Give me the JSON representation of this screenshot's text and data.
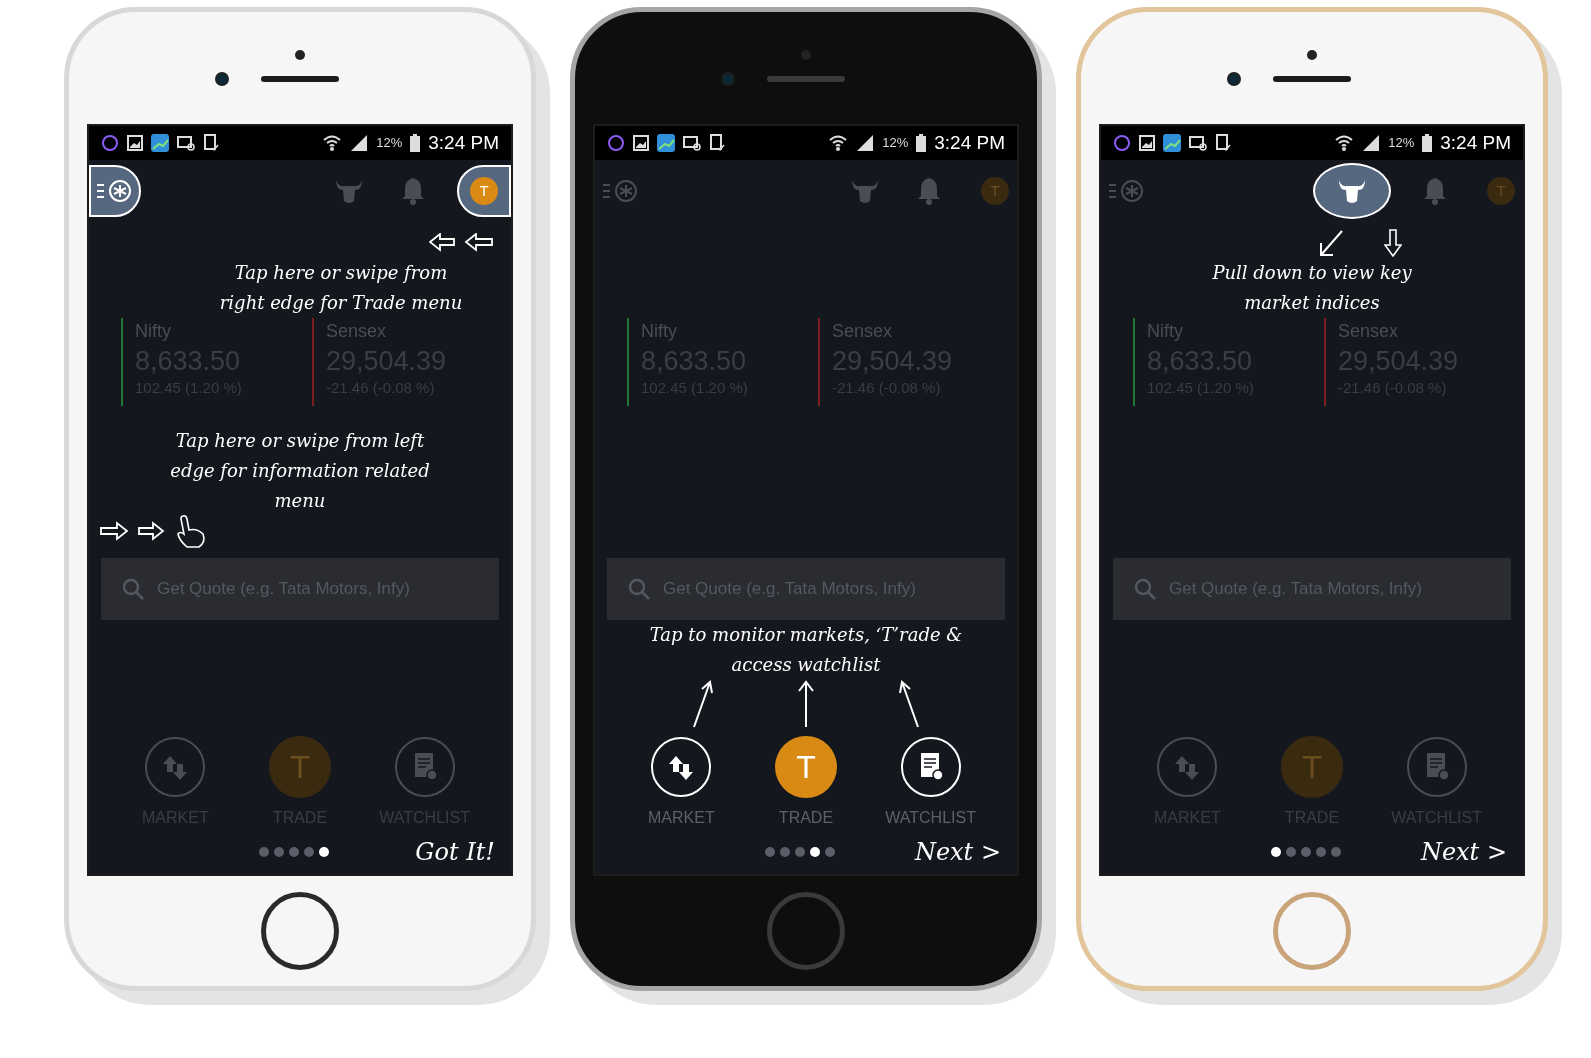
{
  "phones": [
    {
      "kind": "white",
      "status_bar": {
        "battery": "12%",
        "time": "3:24 PM"
      },
      "top_bar": {
        "menu_highlighted": true,
        "bull_highlighted": false,
        "avatar_highlighted": true,
        "avatar": "T"
      },
      "indices": [
        {
          "name": "Nifty",
          "value": "8,633.50",
          "change": "102.45 (1.20 %)",
          "color": "#1f7a3a"
        },
        {
          "name": "Sensex",
          "value": "29,504.39",
          "change": "-21.46 (-0.08 %)",
          "color": "#7a1f1f"
        }
      ],
      "search": {
        "placeholder": "Get Quote (e.g. Tata Motors, Infy)"
      },
      "callouts": [
        {
          "kind": "swipe-right",
          "text": "Tap here or swipe from right edge for Trade menu"
        },
        {
          "kind": "swipe-left",
          "text": "Tap here or swipe from left edge for information related menu"
        }
      ],
      "nav_highlighted": false,
      "nav": [
        {
          "kind": "market",
          "label": "MARKET"
        },
        {
          "kind": "trade",
          "letter": "T",
          "label": "TRADE"
        },
        {
          "kind": "watchlist",
          "label": "WATCHLIST"
        }
      ],
      "page_dots": [
        {
          "selected": false
        },
        {
          "selected": false
        },
        {
          "selected": false
        },
        {
          "selected": false
        },
        {
          "selected": true
        }
      ],
      "action": "Got It!"
    },
    {
      "kind": "black",
      "status_bar": {
        "battery": "12%",
        "time": "3:24 PM"
      },
      "top_bar": {
        "menu_highlighted": false,
        "bull_highlighted": false,
        "avatar_highlighted": false,
        "avatar": "T"
      },
      "indices": [
        {
          "name": "Nifty",
          "value": "8,633.50",
          "change": "102.45 (1.20 %)",
          "color": "#1f7a3a"
        },
        {
          "name": "Sensex",
          "value": "29,504.39",
          "change": "-21.46 (-0.08 %)",
          "color": "#7a1f1f"
        }
      ],
      "search": {
        "placeholder": "Get Quote (e.g. Tata Motors, Infy)"
      },
      "callouts": [
        {
          "kind": "tabs",
          "text": "Tap to monitor markets, ‘T’rade & access watchlist"
        }
      ],
      "nav_highlighted": true,
      "nav": [
        {
          "kind": "market",
          "label": "MARKET"
        },
        {
          "kind": "trade",
          "letter": "T",
          "label": "TRADE"
        },
        {
          "kind": "watchlist",
          "label": "WATCHLIST"
        }
      ],
      "page_dots": [
        {
          "selected": false
        },
        {
          "selected": false
        },
        {
          "selected": false
        },
        {
          "selected": true
        },
        {
          "selected": false
        }
      ],
      "action": "Next >"
    },
    {
      "kind": "gold",
      "status_bar": {
        "battery": "12%",
        "time": "3:24 PM"
      },
      "top_bar": {
        "menu_highlighted": false,
        "bull_highlighted": true,
        "avatar_highlighted": false,
        "avatar": "T"
      },
      "indices": [
        {
          "name": "Nifty",
          "value": "8,633.50",
          "change": "102.45 (1.20 %)",
          "color": "#1f7a3a"
        },
        {
          "name": "Sensex",
          "value": "29,504.39",
          "change": "-21.46 (-0.08 %)",
          "color": "#7a1f1f"
        }
      ],
      "search": {
        "placeholder": "Get Quote (e.g. Tata Motors, Infy)"
      },
      "callouts": [
        {
          "kind": "pull",
          "text": "Pull down to view key market indices"
        }
      ],
      "nav_highlighted": false,
      "nav": [
        {
          "kind": "market",
          "label": "MARKET"
        },
        {
          "kind": "trade",
          "letter": "T",
          "label": "TRADE"
        },
        {
          "kind": "watchlist",
          "label": "WATCHLIST"
        }
      ],
      "page_dots": [
        {
          "selected": true
        },
        {
          "selected": false
        },
        {
          "selected": false
        },
        {
          "selected": false
        },
        {
          "selected": false
        }
      ],
      "action": "Next >"
    }
  ]
}
